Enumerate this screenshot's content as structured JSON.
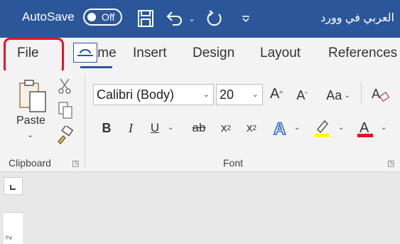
{
  "titlebar": {
    "autosave_label": "AutoSave",
    "autosave_state": "Off",
    "save_icon": "save-icon",
    "undo_icon": "undo-icon",
    "redo_icon": "redo-icon",
    "customize_icon": "customize-qat-icon",
    "document_title": "العربي في وورد"
  },
  "tabs": {
    "file": "File",
    "home": "Home",
    "insert": "Insert",
    "design": "Design",
    "layout": "Layout",
    "references": "References"
  },
  "clipboard": {
    "paste": "Paste",
    "group_label": "Clipboard"
  },
  "font": {
    "family": "Calibri (Body)",
    "size": "20",
    "bold": "B",
    "italic": "I",
    "underline": "U",
    "strikethrough": "ab",
    "subscript": "x",
    "superscript": "x",
    "change_case": "Aa",
    "group_label": "Font"
  },
  "ruler": {
    "vertical_number": "2"
  },
  "colors": {
    "title_bar": "#2b579a",
    "highlight_border": "#e81123",
    "font_color_red": "#e81123",
    "highlight_yellow": "#ffff00"
  }
}
